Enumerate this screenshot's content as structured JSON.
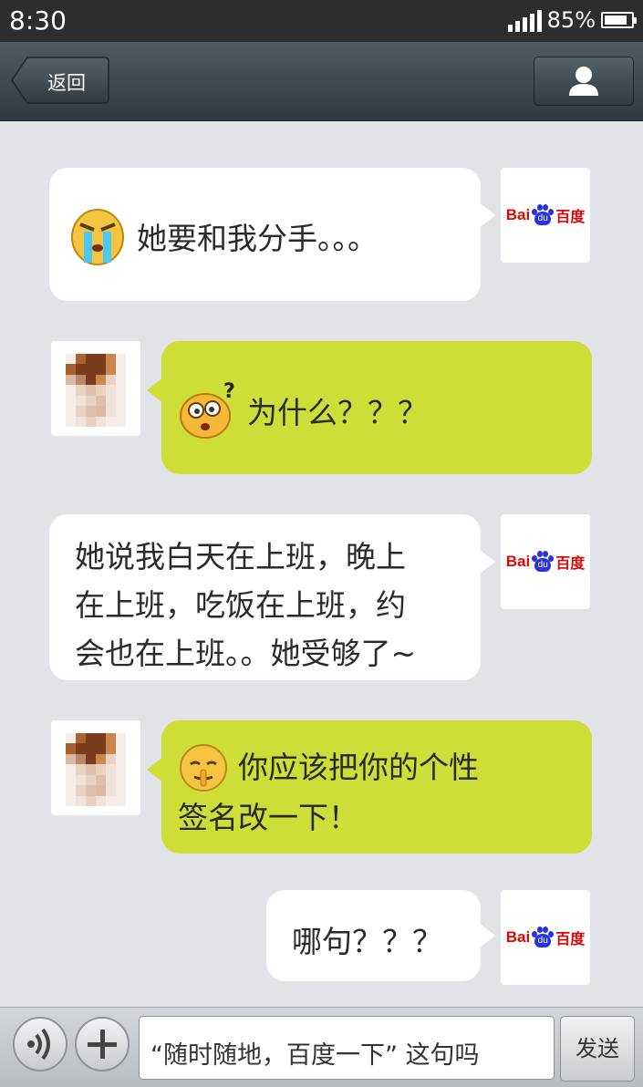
{
  "status_bar": {
    "time": "8:30",
    "battery": "85%",
    "battery_level": 0.85
  },
  "header": {
    "back_label": "返回",
    "profile_icon": "person-icon"
  },
  "messages": [
    {
      "side": "left",
      "sender": "baidu",
      "emoji": "crying-face",
      "text": "她要和我分手。。。"
    },
    {
      "side": "right",
      "sender": "user",
      "emoji": "confused-face",
      "text": "为什么？？？"
    },
    {
      "side": "left",
      "sender": "baidu",
      "emoji": "",
      "lines": [
        "她说我白天在上班，晚上",
        "在上班，吃饭在上班，约",
        "会也在上班。。她受够了~"
      ]
    },
    {
      "side": "right",
      "sender": "user",
      "emoji": "shush-face",
      "lines": [
        "你应该把你的个性",
        "签名改一下！"
      ]
    },
    {
      "side": "left",
      "sender": "baidu",
      "emoji": "",
      "text": "哪句？？？"
    }
  ],
  "baidu_logo": {
    "bai": "Bai",
    "du_mark": "du",
    "du": "百度"
  },
  "input_bar": {
    "voice_icon": "voice-icon",
    "plus_icon": "plus-icon",
    "input_value": "“随时随地，百度一下” 这句吗",
    "send_label": "发送"
  },
  "colors": {
    "green_bubble": "#cfdd38",
    "header": "#3b474e",
    "background": "#e1e3e6"
  }
}
